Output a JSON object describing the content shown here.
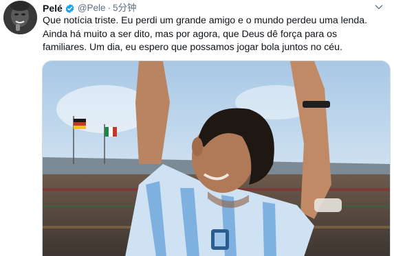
{
  "tweet": {
    "author_name": "Pelé",
    "handle": "@Pele",
    "separator": "·",
    "timestamp": "5分钟",
    "text": "Que notícia triste. Eu perdi um grande amigo e o mundo perdeu uma lenda.\nAinda há muito a ser dito, mas por agora, que Deus dê força para os\nfamiliares. Um dia, eu espero que possamos jogar bola juntos no céu.",
    "verified": true
  },
  "icons": {
    "verified": "verified-badge-icon",
    "more": "chevron-down-icon"
  },
  "colors": {
    "verified_blue": "#1da1f2",
    "handle_gray": "#5b7083",
    "text": "#0f1419"
  }
}
